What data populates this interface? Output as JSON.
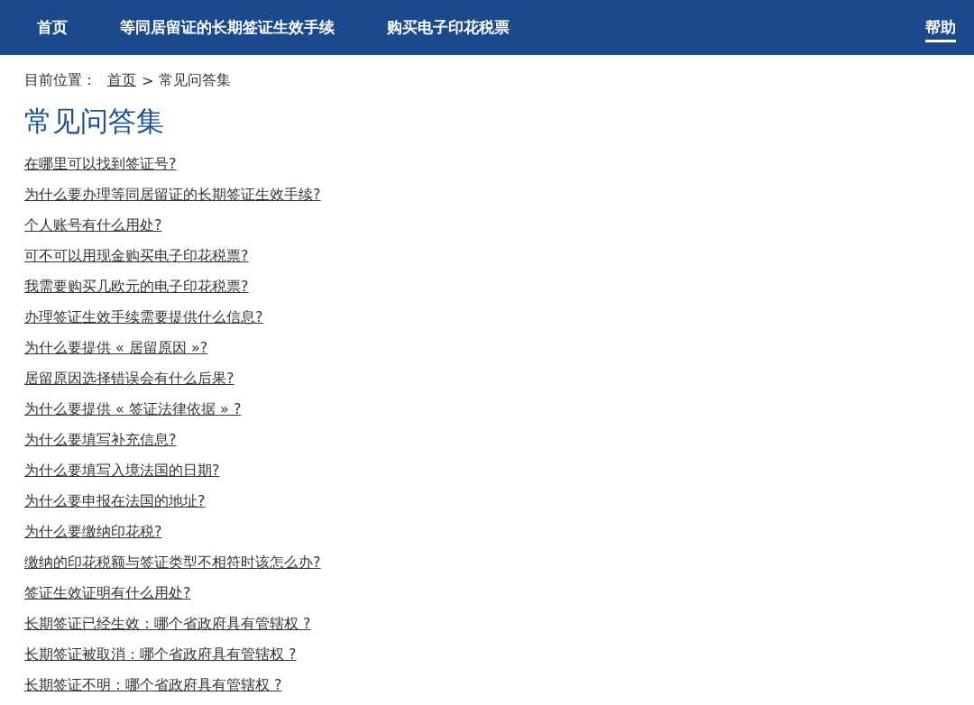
{
  "nav": {
    "items": [
      {
        "label": "首页",
        "selected": false
      },
      {
        "label": "等同居留证的长期签证生效手续",
        "selected": false
      },
      {
        "label": "购买电子印花税票",
        "selected": false
      }
    ],
    "right_items": [
      {
        "label": "帮助",
        "selected": true
      }
    ]
  },
  "breadcrumb": {
    "prefix": "目前位置：",
    "link": "首页",
    "separator": ">",
    "current": "常见问答集"
  },
  "title": "常见问答集",
  "questions": [
    "在哪里可以找到签证号?",
    "为什么要办理等同居留证的长期签证生效手续?",
    "个人账号有什么用处?",
    "可不可以用现金购买电子印花税票?",
    "我需要购买几欧元的电子印花税票?",
    "办理签证生效手续需要提供什么信息?",
    "为什么要提供 « 居留原因 »?",
    "居留原因选择错误会有什么后果?",
    "为什么要提供 « 签证法律依据 » ?",
    "为什么要填写补充信息?",
    "为什么要填写入境法国的日期?",
    "为什么要申报在法国的地址?",
    "为什么要缴纳印花税?",
    "缴纳的印花税额与签证类型不相符时该怎么办?",
    "签证生效证明有什么用处?",
    "长期签证已经生效：哪个省政府具有管辖权 ?",
    "长期签证被取消：哪个省政府具有管辖权 ?",
    "长期签证不明：哪个省政府具有管辖权 ?"
  ]
}
